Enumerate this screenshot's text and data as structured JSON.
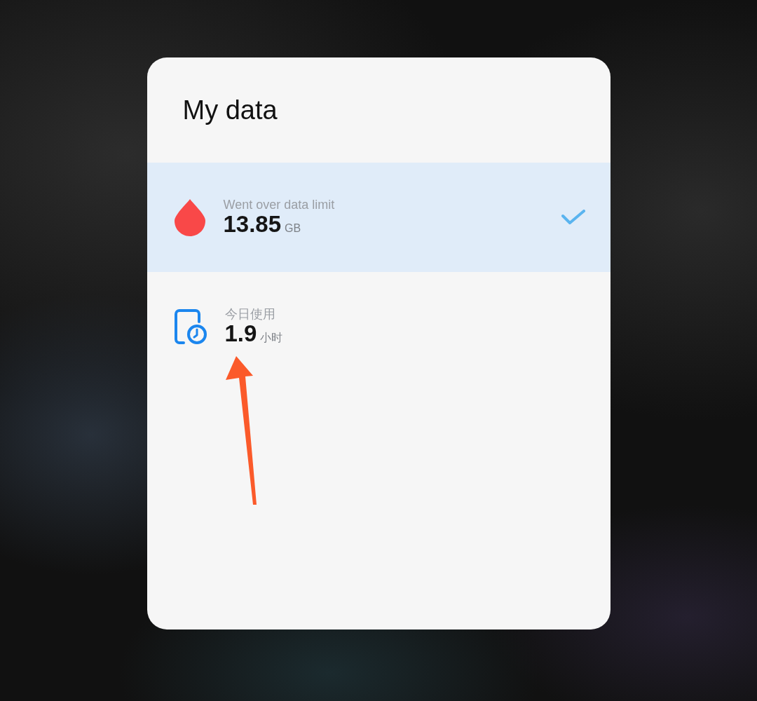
{
  "title": "My data",
  "items": [
    {
      "kind": "data",
      "label": "Went over data limit",
      "value": "13.85",
      "unit": "GB",
      "selected": true
    },
    {
      "kind": "screen_time",
      "label": "今日使用",
      "value": "1.9",
      "unit": "小时",
      "selected": false
    }
  ]
}
